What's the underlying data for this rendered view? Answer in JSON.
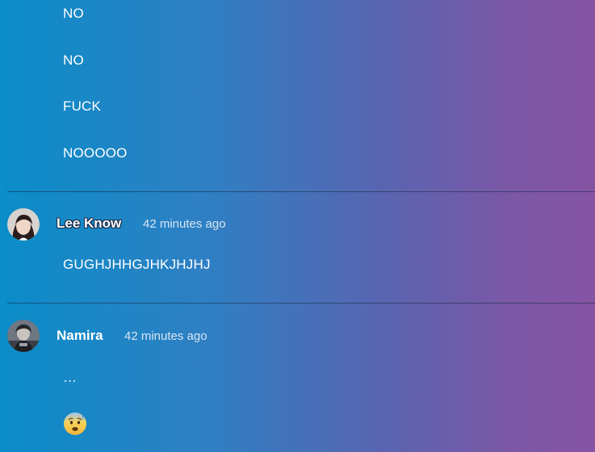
{
  "first_comment_tail": {
    "lines": [
      "NO",
      "NO",
      "FUCK",
      "NOOOOO"
    ]
  },
  "comments": [
    {
      "author": "Lee Know",
      "time": "42 minutes ago",
      "lines": [
        "GUGHJHHGJHKJHJHJ"
      ]
    },
    {
      "author": "Namira",
      "time": "42 minutes ago",
      "lines": [
        "…"
      ],
      "emoji": "anxious-face-with-sweat-emoji"
    }
  ],
  "colors": {
    "gradient_start": "#0a8dc8",
    "gradient_end": "#8654a3",
    "text": "#ffffff",
    "timestamp": "#d8e6f2"
  }
}
